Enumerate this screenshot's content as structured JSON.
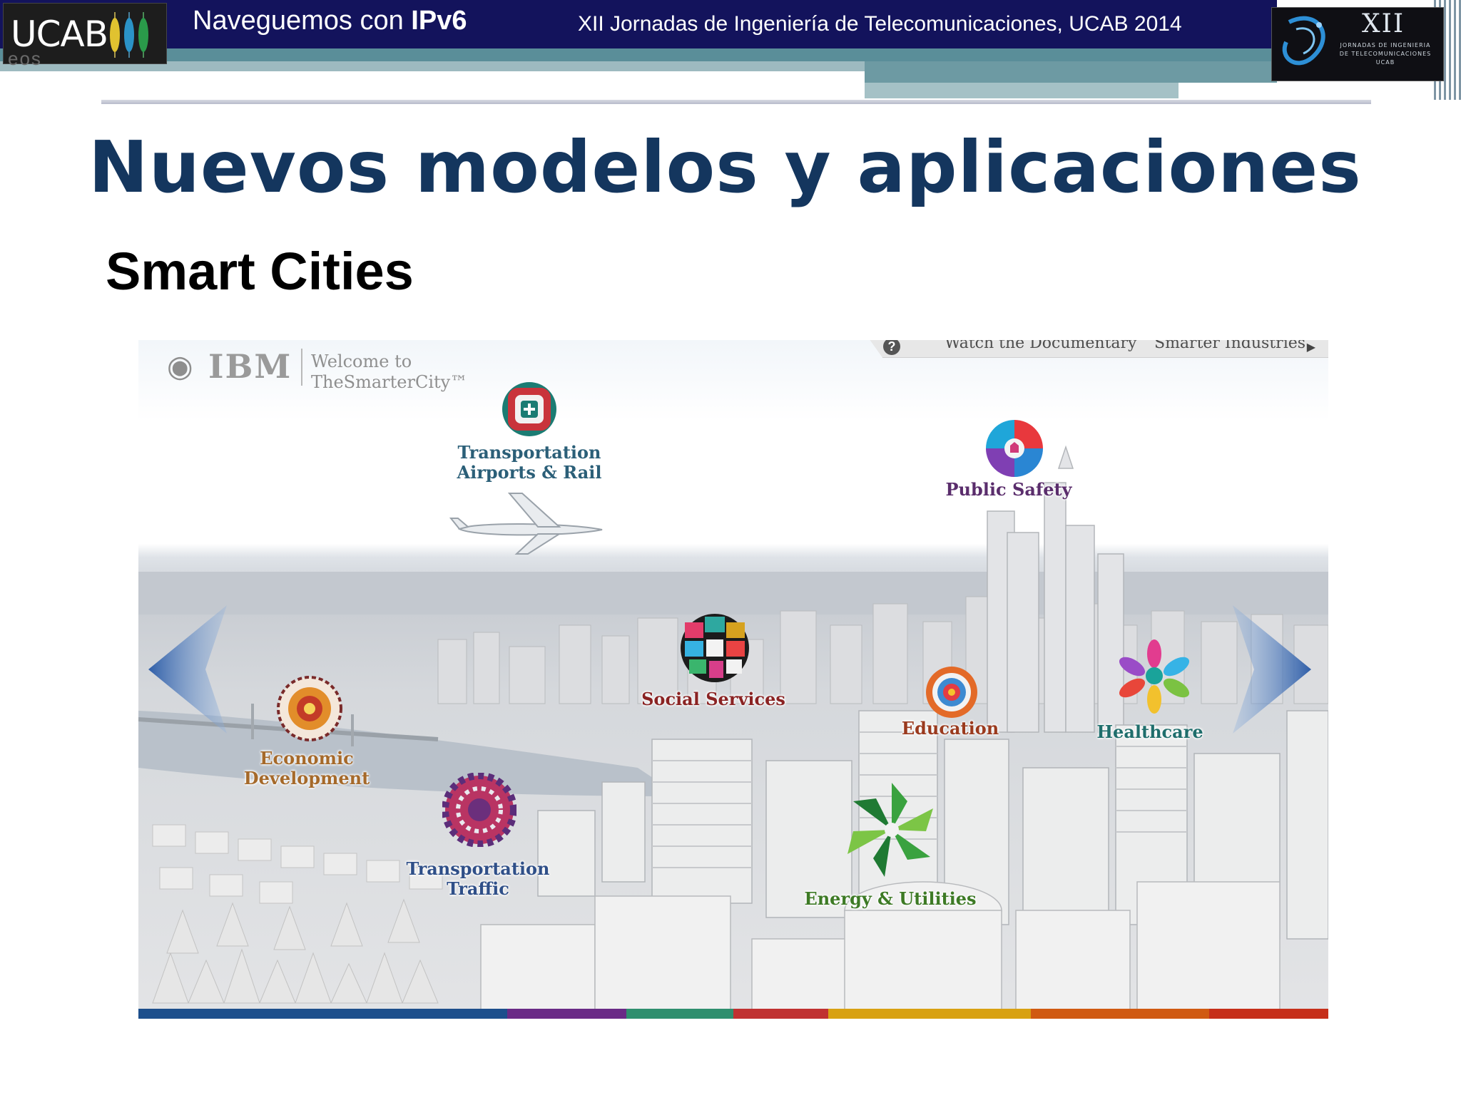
{
  "header": {
    "left_title_prefix": "Naveguemos con ",
    "left_title_bold": "IPv6",
    "right_title": "XII Jornadas de Ingeniería de Telecomunicaciones, UCAB 2014",
    "ucab_logo_text": "UCAB",
    "xii_logo": {
      "number": "XII",
      "line1": "JORNADAS DE INGENIERIA",
      "line2": "DE TELECOMUNICACIONES",
      "line3": "UCAB"
    }
  },
  "slide": {
    "title": "Nuevos modelos y aplicaciones",
    "subtitle": "Smart Cities"
  },
  "ibm": {
    "brand": "IBM",
    "welcome_line1": "Welcome to",
    "welcome_line2": "TheSmarterCity™",
    "nav_help": "?",
    "nav_documentary": "Watch the Documentary",
    "nav_industries": "Smarter Industries",
    "categories": {
      "transport_air": {
        "line1": "Transportation",
        "line2": "Airports & Rail",
        "color": "#2b5f78"
      },
      "public_safety": {
        "line1": "Public Safety",
        "color": "#5a2d6c"
      },
      "social": {
        "line1": "Social Services",
        "color": "#8a2323"
      },
      "economic": {
        "line1": "Economic",
        "line2": "Development",
        "color": "#a5692a"
      },
      "education": {
        "line1": "Education",
        "color": "#9a3a1e"
      },
      "healthcare": {
        "line1": "Healthcare",
        "color": "#1f6e6c"
      },
      "transport_traffic": {
        "line1": "Transportation",
        "line2": "Traffic",
        "color": "#2f4f88"
      },
      "energy": {
        "line1": "Energy & Utilities",
        "color": "#3d7a25"
      }
    },
    "strip_colors": [
      "#1d4f8c",
      "#6a2a86",
      "#2f8f6e",
      "#c03131",
      "#d8a112",
      "#d05a12",
      "#c62f1a"
    ]
  }
}
